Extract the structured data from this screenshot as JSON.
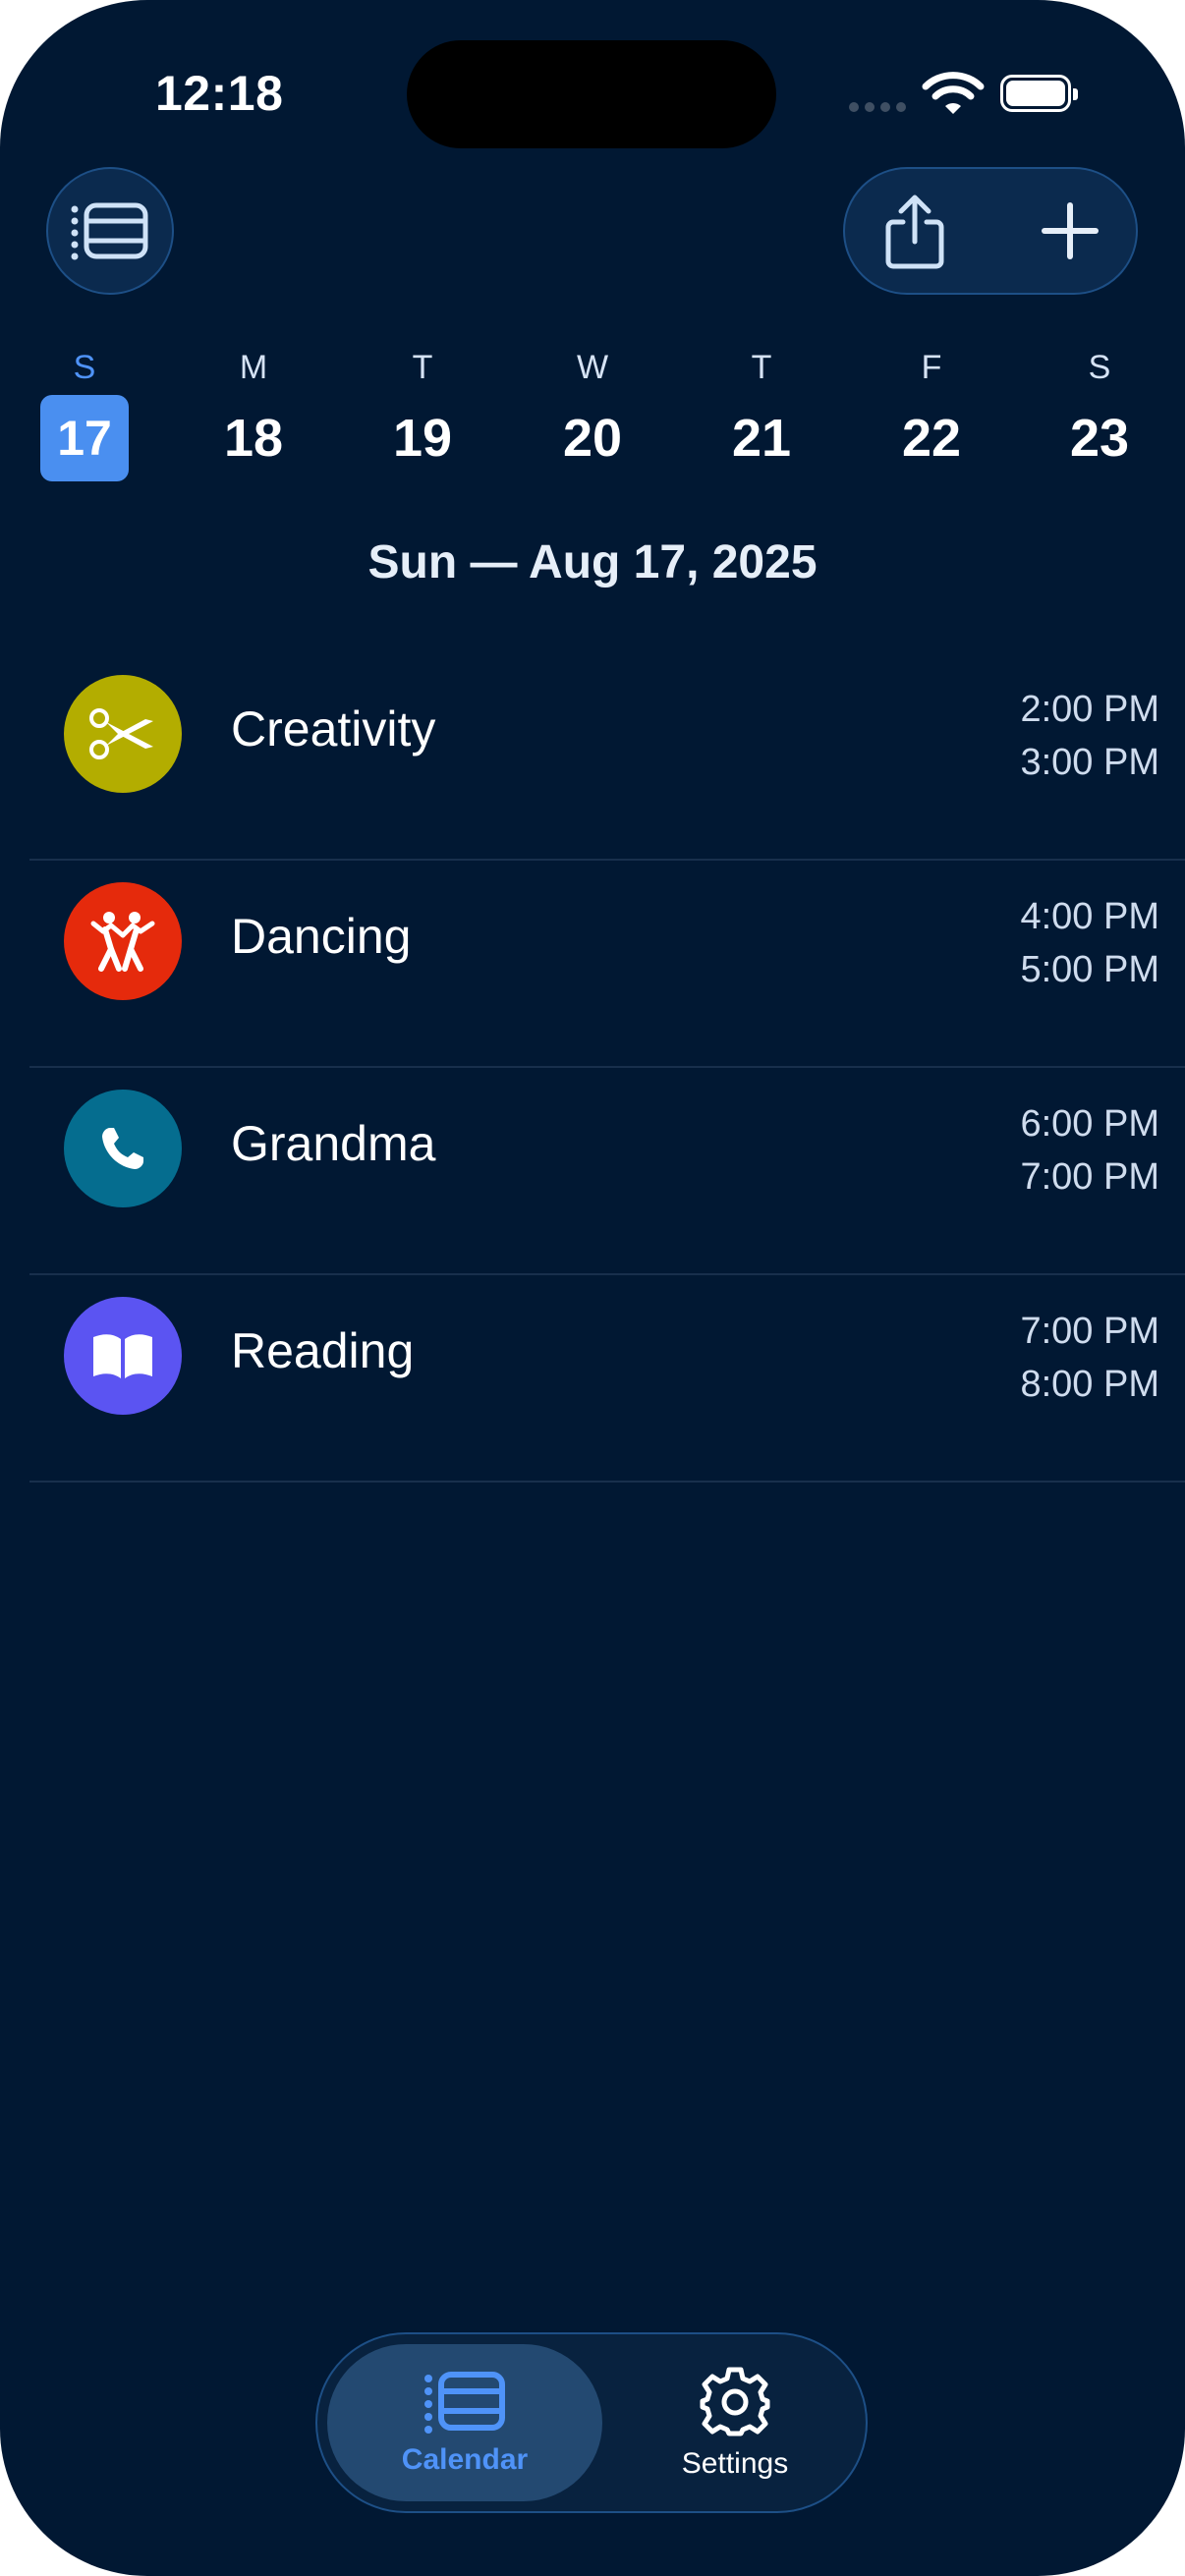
{
  "status_bar": {
    "time": "12:18"
  },
  "toolbar": {
    "list_icon": "calendar-list-icon",
    "share_icon": "share-icon",
    "add_icon": "plus-icon"
  },
  "week": {
    "days": [
      {
        "letter": "S",
        "number": "17",
        "selected": true
      },
      {
        "letter": "M",
        "number": "18"
      },
      {
        "letter": "T",
        "number": "19"
      },
      {
        "letter": "W",
        "number": "20"
      },
      {
        "letter": "T",
        "number": "21"
      },
      {
        "letter": "F",
        "number": "22"
      },
      {
        "letter": "S",
        "number": "23"
      }
    ],
    "selected_color": "#4a8ff0"
  },
  "date_title": "Sun — Aug 17, 2025",
  "events": [
    {
      "name": "Creativity",
      "start": "2:00 PM",
      "end": "3:00 PM",
      "icon": "scissors-icon",
      "color": "#b3ad00"
    },
    {
      "name": "Dancing",
      "start": "4:00 PM",
      "end": "5:00 PM",
      "icon": "dancing-icon",
      "color": "#e52a0c"
    },
    {
      "name": "Grandma",
      "start": "6:00 PM",
      "end": "7:00 PM",
      "icon": "phone-icon",
      "color": "#056d8f"
    },
    {
      "name": "Reading",
      "start": "7:00 PM",
      "end": "8:00 PM",
      "icon": "book-icon",
      "color": "#5b54f2"
    }
  ],
  "tabbar": {
    "tabs": [
      {
        "label": "Calendar",
        "icon": "calendar-list-icon",
        "active": true
      },
      {
        "label": "Settings",
        "icon": "gear-icon",
        "active": false
      }
    ],
    "accent": "#4f93f8"
  }
}
